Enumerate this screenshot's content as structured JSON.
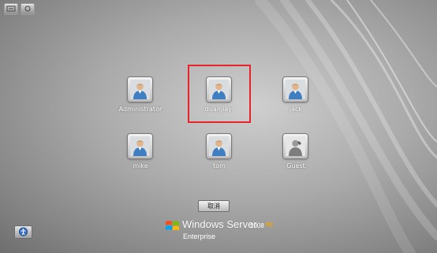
{
  "users": [
    {
      "name": "Administrator",
      "icon": "user-avatar-icon"
    },
    {
      "name": "duanjiayi",
      "icon": "user-avatar-icon",
      "selected": true
    },
    {
      "name": "jack",
      "icon": "user-avatar-icon"
    },
    {
      "name": "mike",
      "icon": "user-avatar-icon"
    },
    {
      "name": "tom",
      "icon": "user-avatar-icon"
    },
    {
      "name": "Guest",
      "icon": "guest-avatar-icon"
    }
  ],
  "cancel_label": "取消",
  "brand": {
    "name": "Windows Server",
    "version": "2008",
    "release": "R2",
    "edition": "Enterprise"
  },
  "colors": {
    "highlight": "#e8232a",
    "background": "#a9a9a9",
    "label": "#ffffff"
  }
}
